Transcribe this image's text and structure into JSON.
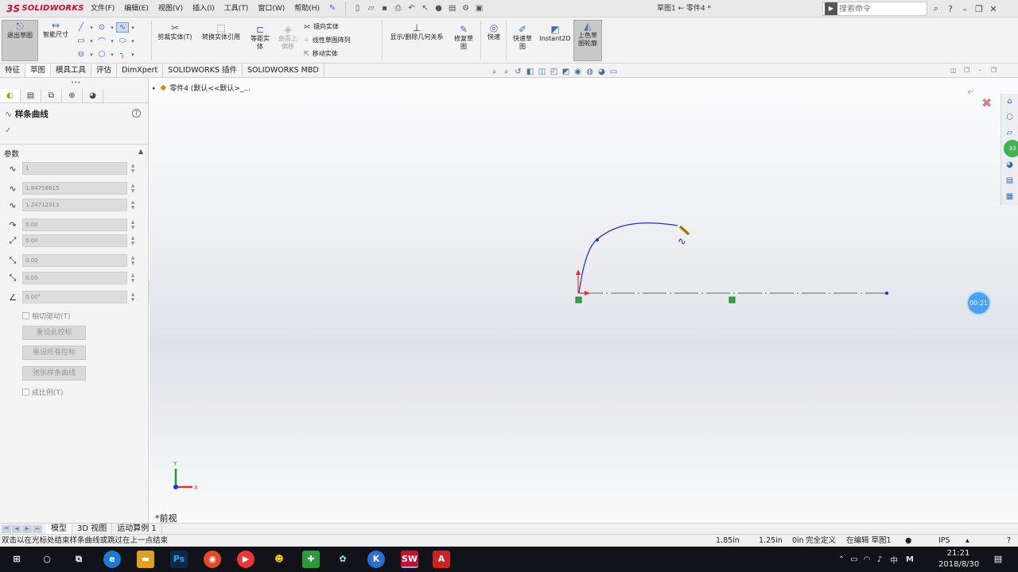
{
  "app": {
    "logo_text": "SOLIDWORKS",
    "logo_mark": "3S",
    "title": "草图1 ← 零件4 *",
    "search_placeholder": "搜索命令"
  },
  "menu": [
    "文件(F)",
    "编辑(E)",
    "视图(V)",
    "插入(I)",
    "工具(T)",
    "窗口(W)",
    "帮助(H)"
  ],
  "commands": {
    "exit_sketch": "退出草图",
    "smart_dim": "智能尺寸",
    "trim": "剪裁实体(T)",
    "convert": "转换实体引用",
    "offset_1": "等距实",
    "offset_2": "体",
    "offset_surface_1": "曲面上",
    "offset_surface_2": "偏移",
    "mirror": "镜向实体",
    "linear_pattern": "线性草图阵列",
    "move": "移动实体",
    "relations": "显示/删除几何关系",
    "repair_1": "修复草",
    "repair_2": "图",
    "quick_snap": "快速",
    "rapid_sketch_1": "快速草",
    "rapid_sketch_2": "图",
    "instant2d": "Instant2D",
    "shaded_1": "上色草",
    "shaded_2": "图轮廓"
  },
  "tabs": [
    "特征",
    "草图",
    "模具工具",
    "评估",
    "DimXpert",
    "SOLIDWORKS 插件",
    "SOLIDWORKS MBD"
  ],
  "active_tab": "草图",
  "panel": {
    "title": "样条曲线",
    "section": "参数",
    "fields": {
      "spline_point": "1",
      "x": "1.84758615",
      "y": "1.24712313",
      "tangent_weight_1": "0.00",
      "tangent_weight_2": "0.00",
      "tangent_radial_1": "0.00",
      "tangent_radial_2": "0.00",
      "angle": "0.00°"
    },
    "tangent_driving": "相切驱动(T)",
    "reset_handle": "重设此控标",
    "reset_all": "重设所有控标",
    "relax": "弛张样条曲线",
    "proportional": "成比例(T)"
  },
  "tree_root": "零件4 (默认<<默认>_...",
  "view_label": "*前视",
  "timer": "00:21",
  "green_badge": "33",
  "bottom_tabs": [
    "模型",
    "3D 视图",
    "运动算例 1"
  ],
  "status": {
    "hint": "双击以在光标处结束样条曲线或跳过在上一点结束",
    "x": "1.85in",
    "y": "1.25in",
    "z": "0in",
    "defined": "完全定义",
    "editing": "在编辑 草图1",
    "units": "IPS"
  },
  "taskbar": {
    "time": "21:21",
    "date": "2018/8/30",
    "ime": "中",
    "ime2": "M"
  },
  "colors": {
    "accent": "#c8102e",
    "sketch_blue": "#1f2fd6"
  }
}
